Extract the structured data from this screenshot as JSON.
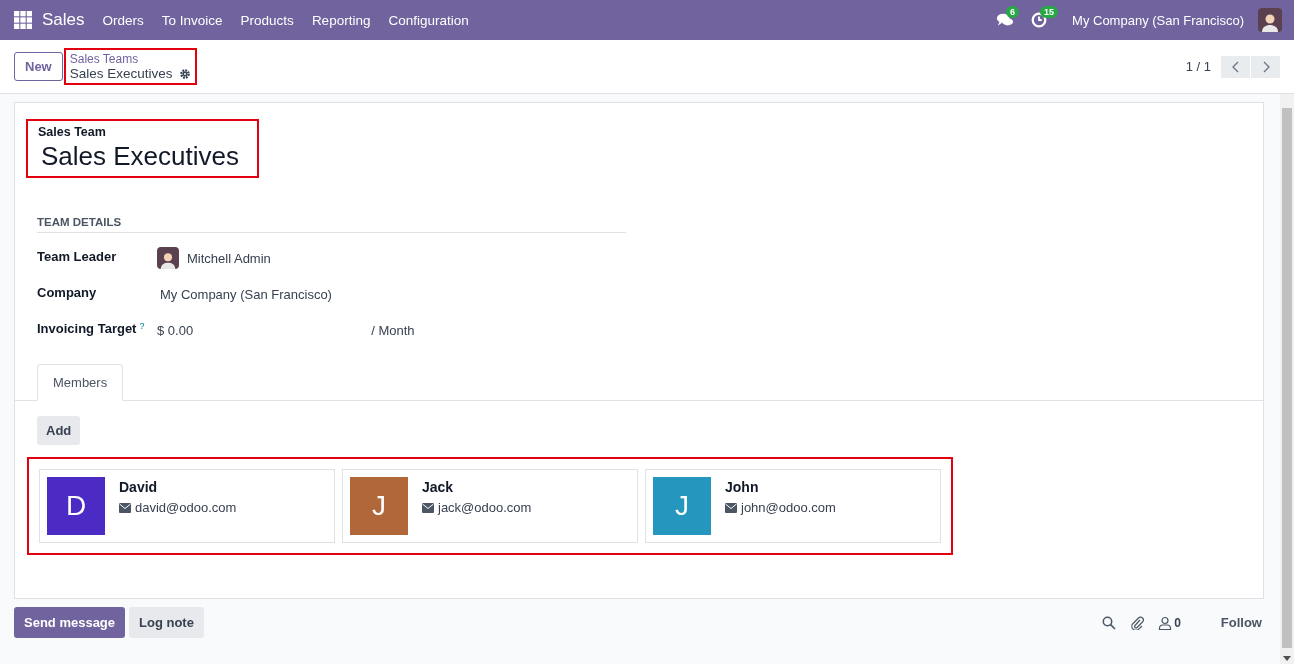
{
  "navbar": {
    "app": "Sales",
    "menu": [
      "Orders",
      "To Invoice",
      "Products",
      "Reporting",
      "Configuration"
    ],
    "messages_badge": "6",
    "activities_badge": "15",
    "company": "My Company (San Francisco)"
  },
  "control_panel": {
    "new_button": "New",
    "breadcrumb": {
      "parent": "Sales Teams",
      "current": "Sales Executives",
      "highlighted": true
    },
    "pager": "1 / 1"
  },
  "form": {
    "header": {
      "label": "Sales Team",
      "title": "Sales Executives",
      "highlighted": true
    },
    "section": "TEAM DETAILS",
    "fields": [
      {
        "kind": "user",
        "label": "Team Leader",
        "value": "Mitchell Admin"
      },
      {
        "kind": "text",
        "label": "Company",
        "value": "My Company (San Francisco)"
      },
      {
        "kind": "monetary",
        "label": "Invoicing Target",
        "help": "?",
        "value": "$ 0.00",
        "suffix": "/ Month"
      }
    ],
    "tabs": [
      {
        "label": "Members",
        "selected": true
      }
    ],
    "add_button": "Add",
    "members": {
      "highlighted": true,
      "items": [
        {
          "initial": "D",
          "name": "David",
          "email": "david@odoo.com",
          "color": "#4c2ac4"
        },
        {
          "initial": "J",
          "name": "Jack",
          "email": "jack@odoo.com",
          "color": "#b0683a"
        },
        {
          "initial": "J",
          "name": "John",
          "email": "john@odoo.com",
          "color": "#2596be"
        }
      ]
    }
  },
  "chatter": {
    "buttons": [
      "Send message",
      "Log note"
    ],
    "followers_count": "0",
    "follow": "Follow"
  }
}
